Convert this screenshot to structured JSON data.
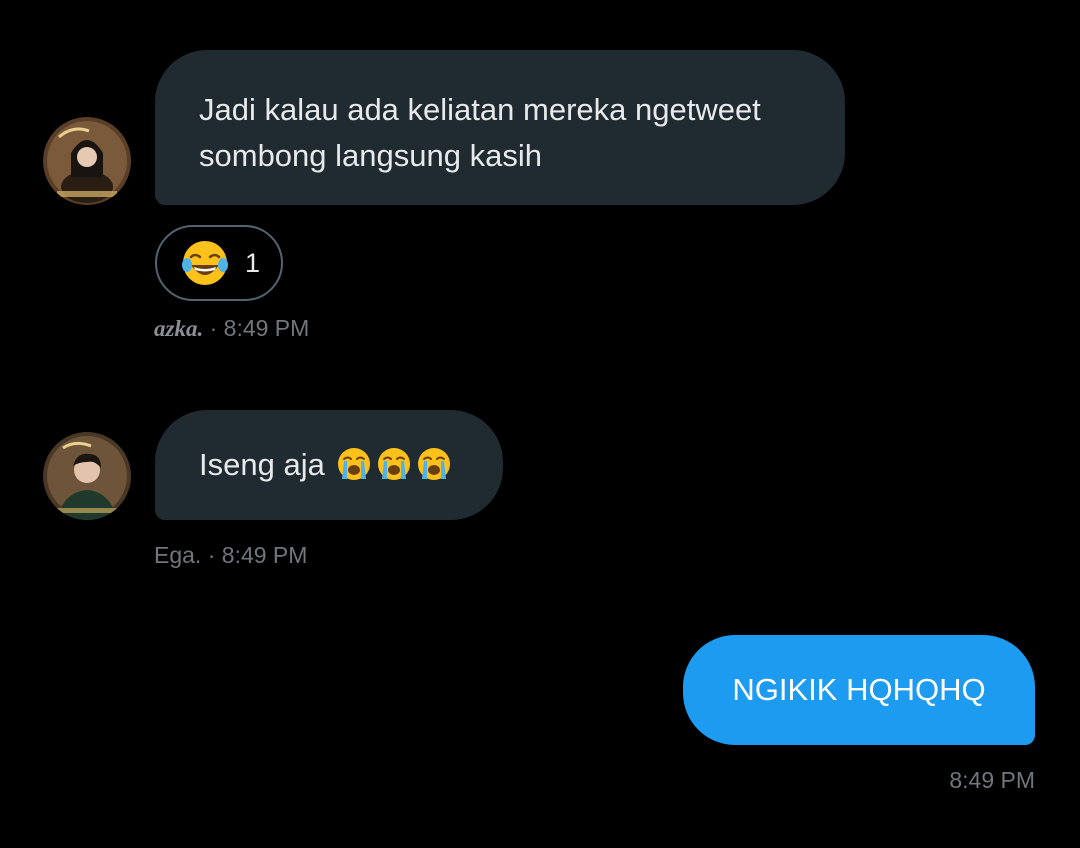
{
  "conversation": {
    "messages": [
      {
        "sender": "azka.",
        "direction": "received",
        "lines": [
          "Jadi kalau ada keliatan mereka ngetweet",
          "sombong langsung kasih"
        ],
        "reaction": {
          "emoji": "face-with-tears-of-joy",
          "count": "1"
        },
        "meta_separator": " · ",
        "time": "8:49 PM"
      },
      {
        "sender": "Ega.",
        "direction": "received",
        "text": "Iseng aja ",
        "emojis": [
          "loudly-crying-face",
          "loudly-crying-face",
          "loudly-crying-face"
        ],
        "meta_separator": " · ",
        "time": "8:49 PM"
      },
      {
        "sender": "",
        "direction": "sent",
        "text": "NGIKIK HQHQHQ",
        "time": "8:49 PM"
      }
    ]
  },
  "colors": {
    "background": "#000000",
    "received_bubble": "#202a31",
    "sent_bubble": "#1d9bf0",
    "meta_text": "#71767b",
    "reaction_border": "#536471"
  }
}
